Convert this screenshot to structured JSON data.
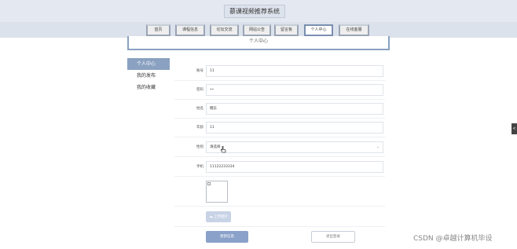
{
  "header": {
    "site_title": "慕课视频推荐系统"
  },
  "nav": {
    "items": [
      {
        "label": "首页"
      },
      {
        "label": "课程信息"
      },
      {
        "label": "论坛交流"
      },
      {
        "label": "网站公告"
      },
      {
        "label": "留言板"
      },
      {
        "label": "个人中心"
      },
      {
        "label": "在线客服"
      }
    ],
    "active": "个人中心"
  },
  "banner": {
    "title": "个人中心"
  },
  "sidebar": {
    "items": [
      {
        "label": "个人中心"
      },
      {
        "label": "我的发布"
      },
      {
        "label": "我的收藏"
      }
    ]
  },
  "form": {
    "account": {
      "label": "账号",
      "value": "11"
    },
    "password": {
      "label": "密码",
      "value": "••"
    },
    "name": {
      "label": "姓名",
      "value": "魏东"
    },
    "age": {
      "label": "年龄",
      "value": "11"
    },
    "gender": {
      "label": "性别",
      "placeholder": "请选择",
      "value": "请选择"
    },
    "phone": {
      "label": "手机",
      "value": "11122233334"
    },
    "upload_label": "上传图片",
    "update_button": "更新信息",
    "logout_button": "退出登录"
  },
  "side_tab": {
    "icon": "collapse-arrow-icon",
    "label": "<"
  },
  "watermark": {
    "text": "CSDN @卓越计算机毕设"
  },
  "colors": {
    "accent": "#8aa1c1",
    "primary_button": "#8aa1c9",
    "header_bg": "#e4e8f0"
  }
}
